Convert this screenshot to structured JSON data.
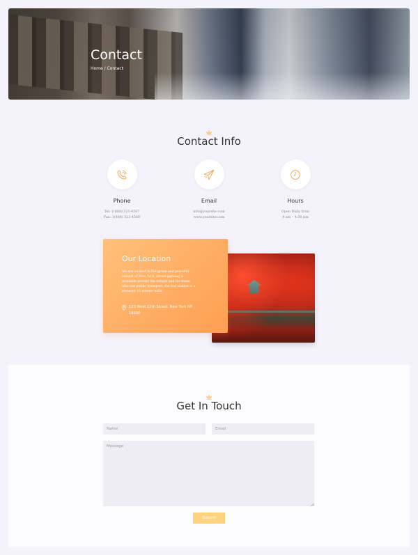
{
  "hero": {
    "title": "Contact",
    "breadcrumb": "Home / Contact"
  },
  "contact_info": {
    "title": "Contact Info",
    "items": [
      {
        "icon": "phone-icon",
        "label": "Phone",
        "lines": [
          "Tel: 1(888) 323-4567",
          "Fax: 1(888) 323-4568"
        ]
      },
      {
        "icon": "paper-plane-icon",
        "label": "Email",
        "lines": [
          "info@yoursite.com",
          "www.yoursite.com"
        ]
      },
      {
        "icon": "clock-icon",
        "label": "Hours",
        "lines": [
          "Open Daily from",
          "9 am – 4:30 pm"
        ]
      }
    ]
  },
  "location": {
    "title": "Our Location",
    "text": "We are located in the green and peaceful suburb of New York. Street parking is available around the temple and for those who use public transport, the bus station is a pleasant 15 minute walk.",
    "address": "123 West 12th Street, New York NY 19030"
  },
  "get_in_touch": {
    "title": "Get In Touch",
    "name_placeholder": "Name",
    "email_placeholder": "Email",
    "message_placeholder": "Message",
    "submit_label": "Submit"
  },
  "colors": {
    "accent": "#ff9e52",
    "accent_light": "#ffc07a",
    "submit": "#ffd27c",
    "background": "#f4f2fa"
  }
}
